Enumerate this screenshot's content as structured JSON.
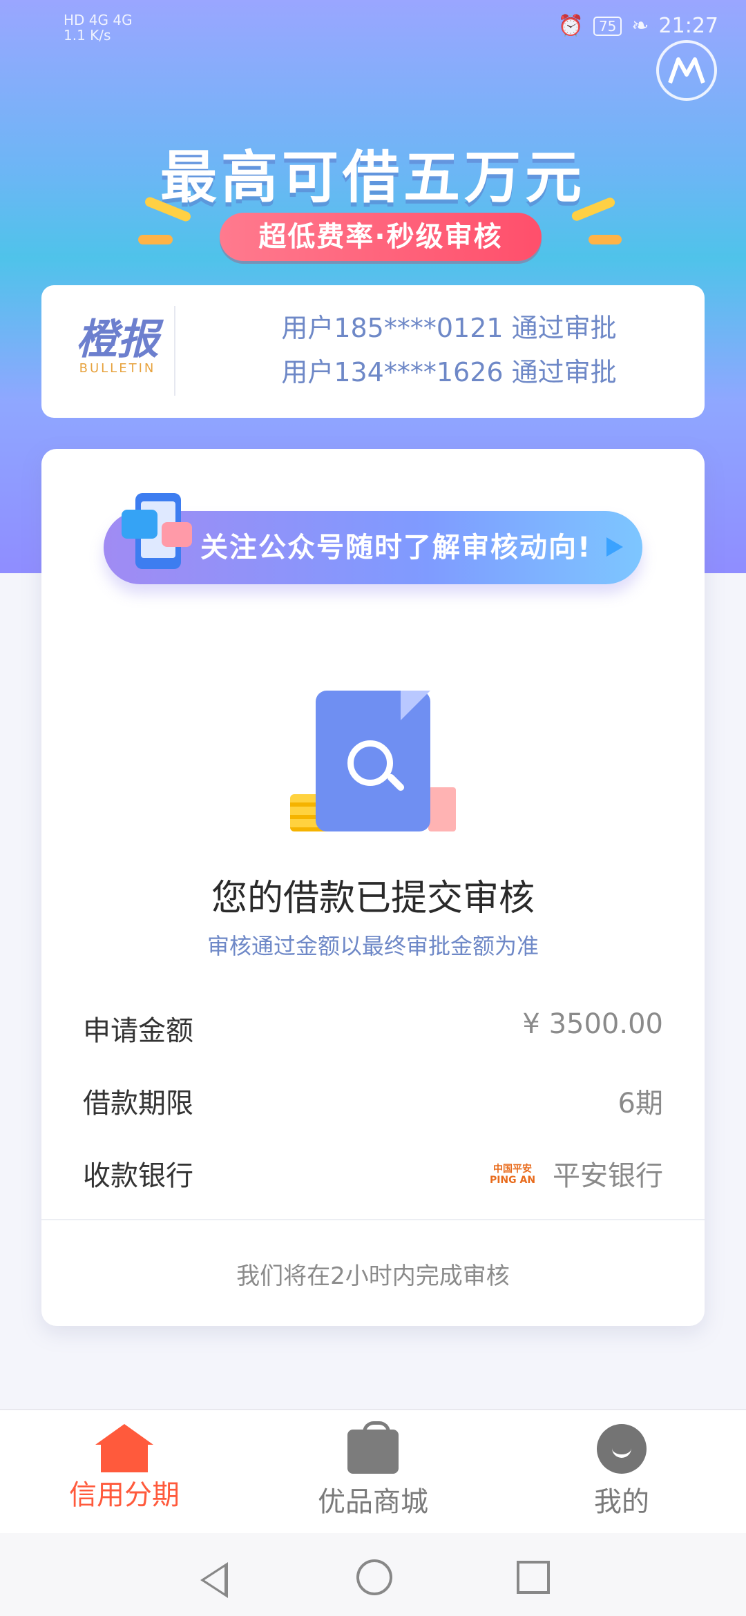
{
  "status_bar": {
    "network_left": "HD 4G 4G",
    "speed": "1.1 K/s",
    "battery": "75",
    "time": "21:27"
  },
  "hero": {
    "title": "最高可借五万元",
    "pill": "超低费率·秒级审核"
  },
  "bulletin": {
    "logo_cn": "橙报",
    "logo_en": "BULLETIN",
    "lines": [
      "用户185****0121 通过审批",
      "用户134****1626 通过审批"
    ]
  },
  "banner": {
    "text": "关注公众号随时了解审核动向!"
  },
  "review": {
    "title": "您的借款已提交审核",
    "subtitle": "审核通过金额以最终审批金额为准"
  },
  "details": [
    {
      "label": "申请金额",
      "value": "¥ 3500.00"
    },
    {
      "label": "借款期限",
      "value": "6期"
    },
    {
      "label": "收款银行",
      "value": "平安银行",
      "bank_logo": "中国平安 PING AN"
    }
  ],
  "footer_note": "我们将在2小时内完成审核",
  "tabs": [
    {
      "label": "信用分期",
      "icon": "home-icon",
      "active": true
    },
    {
      "label": "优品商城",
      "icon": "bag-icon",
      "active": false
    },
    {
      "label": "我的",
      "icon": "profile-icon",
      "active": false
    }
  ],
  "colors": {
    "accent": "#ff5a3c",
    "link_blue": "#6e88c7",
    "pill_red": "#ff4f6b"
  }
}
